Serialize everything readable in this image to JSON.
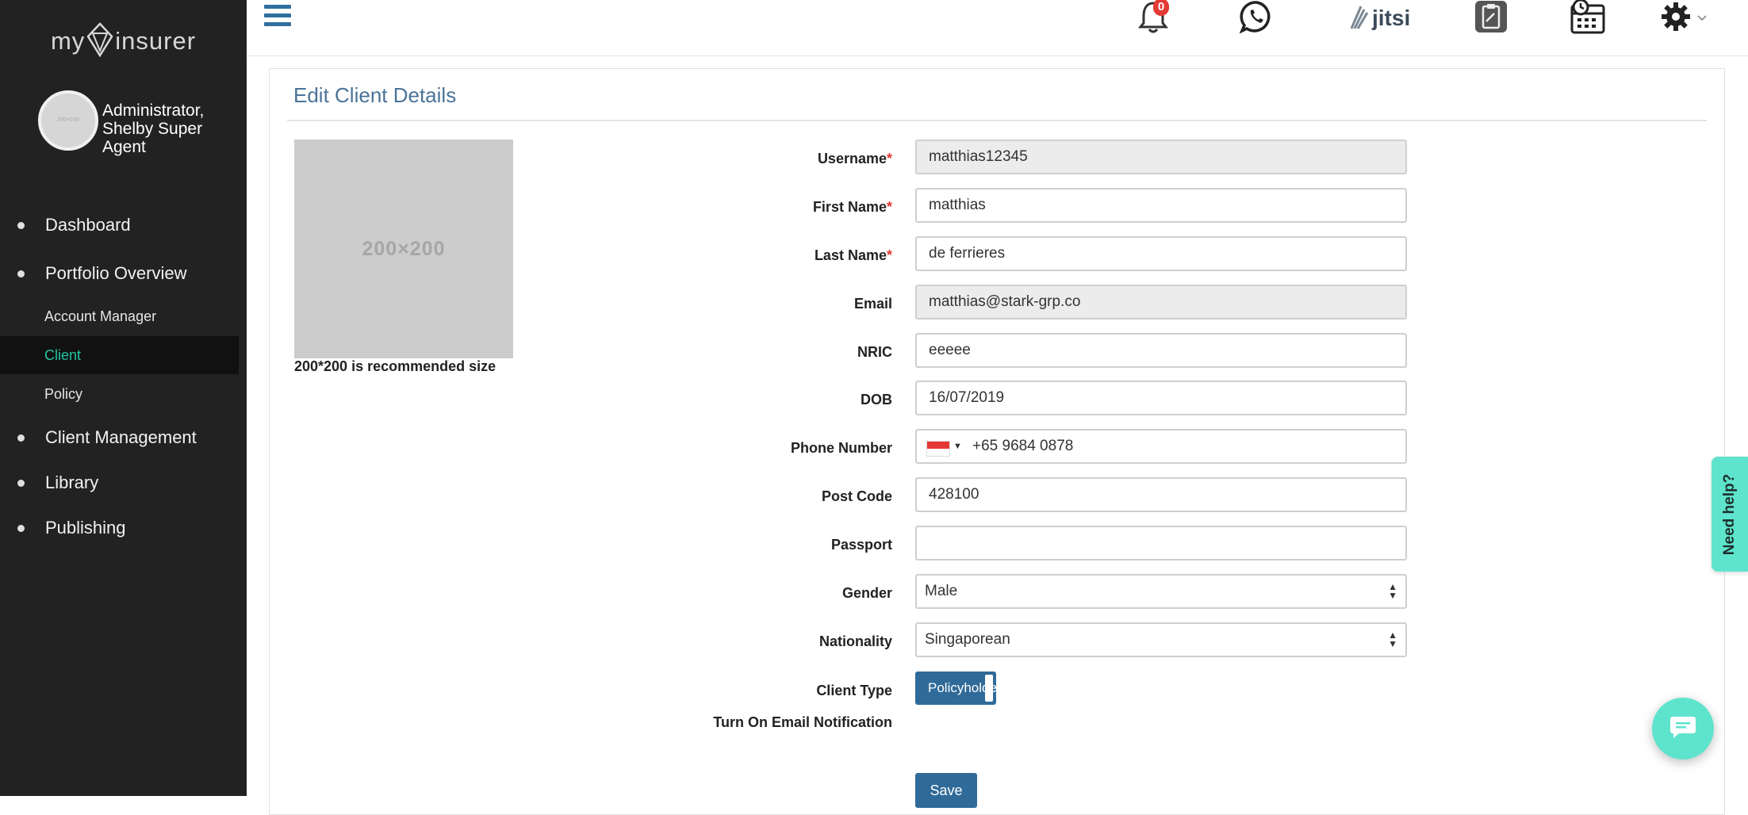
{
  "app": {
    "brand_left": "my",
    "brand_right": "insurer",
    "accent_color": "#21c3a3",
    "primary_color": "#2f6a99"
  },
  "sidebar": {
    "avatar_text": "200×200",
    "user_line1": "Administrator,",
    "user_line2": "Shelby Super",
    "user_line3": "Agent",
    "items": [
      {
        "label": "Dashboard"
      },
      {
        "label": "Portfolio Overview"
      },
      {
        "label": "Client Management"
      },
      {
        "label": "Library"
      },
      {
        "label": "Publishing"
      }
    ],
    "sub_items": [
      {
        "label": "Account Manager"
      },
      {
        "label": "Client",
        "active": true
      },
      {
        "label": "Policy"
      }
    ]
  },
  "topbar": {
    "notification_count": "0",
    "jitsi_label": "jitsi",
    "icons": [
      "menu-icon",
      "bell-icon",
      "whatsapp-icon",
      "jitsi-icon",
      "clipboard-icon",
      "calendar-icon",
      "gear-icon",
      "chevron-down-icon"
    ]
  },
  "form": {
    "title": "Edit Client Details",
    "photo_placeholder": "200×200",
    "photo_note": "200*200 is recommended size",
    "required_mark": "*",
    "fields": {
      "username": {
        "label": "Username",
        "value": "matthias12345"
      },
      "first_name": {
        "label": "First Name",
        "value": "matthias"
      },
      "last_name": {
        "label": "Last Name",
        "value": "de ferrieres"
      },
      "email": {
        "label": "Email",
        "value": "matthias@stark-grp.co"
      },
      "nric": {
        "label": "NRIC",
        "value": "eeeee"
      },
      "dob": {
        "label": "DOB",
        "value": "16/07/2019"
      },
      "phone": {
        "label": "Phone Number",
        "value": "+65 9684 0878"
      },
      "post_code": {
        "label": "Post Code",
        "value": "428100"
      },
      "passport": {
        "label": "Passport",
        "value": ""
      },
      "gender": {
        "label": "Gender",
        "value": "Male"
      },
      "nationality": {
        "label": "Nationality",
        "value": "Singaporean"
      },
      "client_type": {
        "label": "Client Type",
        "value": "Policyholder"
      },
      "email_notification": {
        "label": "Turn On Email Notification"
      }
    },
    "save_label": "Save"
  },
  "help": {
    "need_help_label": "Need help?"
  }
}
